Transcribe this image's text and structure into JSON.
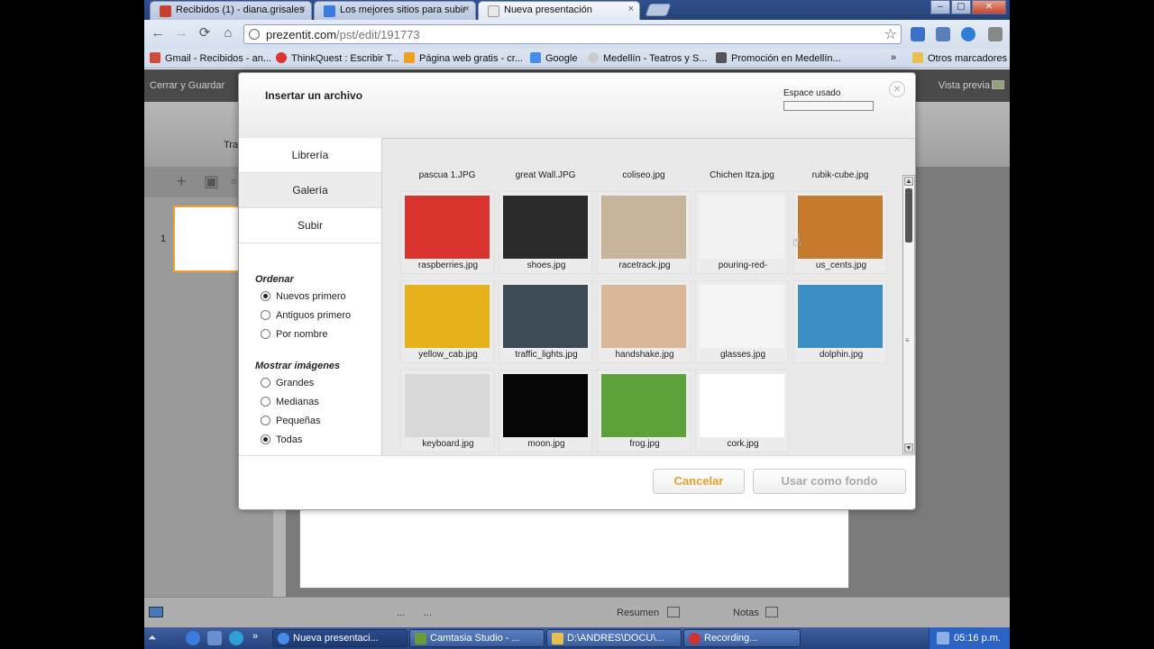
{
  "browser": {
    "tabs": [
      {
        "label": "Recibidos (1) - diana.grisales",
        "favicon_color": "#c8412f"
      },
      {
        "label": "Los mejores sitios para subir",
        "favicon_color": "#3a7be0"
      },
      {
        "label": "Nueva presentación",
        "favicon_color": "#e8e8e8"
      }
    ],
    "tab_close_glyph": "×",
    "window_buttons": [
      "–",
      "▢",
      "✕"
    ],
    "nav": {
      "back": "←",
      "forward": "→",
      "reload": "⟳",
      "home": "⌂"
    },
    "url_host": "prezentit.com",
    "url_path": "/pst/edit/191773",
    "star_glyph": "☆",
    "bookmarks": [
      {
        "label": "Gmail - Recibidos - an...",
        "icon_color": "#d14b3b"
      },
      {
        "label": "ThinkQuest : Escribir T...",
        "icon_color": "#d33"
      },
      {
        "label": "Página web gratis - cr...",
        "icon_color": "#f0a020"
      },
      {
        "label": "Google",
        "icon_color": "#4a8be8"
      },
      {
        "label": "Medellín - Teatros y S...",
        "icon_color": "#ccc"
      },
      {
        "label": "Promoción en Medellín...",
        "icon_color": "#555"
      }
    ],
    "bookmarks_overflow": "»",
    "other_bookmarks": "Otros marcadores"
  },
  "app": {
    "close_save": "Cerrar y Guardar",
    "preview": "Vista previa",
    "ribbon_label": "Tra",
    "slide_tools": [
      "+",
      "▣",
      "▫"
    ],
    "slide_number": "1",
    "status": {
      "dots1": "...",
      "dots2": "...",
      "summary": "Resumen",
      "notes": "Notas"
    }
  },
  "dialog": {
    "title": "Insertar un archivo",
    "space_used_label": "Espace usado",
    "space_used_fraction": 0.0,
    "close_glyph": "×",
    "nav_tabs": [
      "Librería",
      "Galería",
      "Subir"
    ],
    "selected_tab": "Galería",
    "sort_heading": "Ordenar",
    "sort_options": [
      {
        "label": "Nuevos primero",
        "checked": true
      },
      {
        "label": "Antiguos primero",
        "checked": false
      },
      {
        "label": "Por nombre",
        "checked": false
      }
    ],
    "show_heading": "Mostrar imágenes",
    "show_options": [
      {
        "label": "Grandes",
        "checked": false
      },
      {
        "label": "Medianas",
        "checked": false
      },
      {
        "label": "Pequeñas",
        "checked": false
      },
      {
        "label": "Todas",
        "checked": true
      }
    ],
    "top_row_labels": [
      "pascua 1.JPG",
      "great Wall.JPG",
      "coliseo.jpg",
      "Chichen Itza.jpg",
      "rubik-cube.jpg"
    ],
    "images": [
      {
        "name": "raspberries.jpg",
        "icon": "raspberries-image",
        "color": "#d8332c"
      },
      {
        "name": "shoes.jpg",
        "icon": "shoes-image",
        "color": "#2a2a2a"
      },
      {
        "name": "racetrack.jpg",
        "icon": "racetrack-image",
        "color": "#c8b49a"
      },
      {
        "name": "pouring-red-",
        "icon": "pouring-red-image",
        "color": "#f2f2f2"
      },
      {
        "name": "us_cents.jpg",
        "icon": "us-cents-image",
        "color": "#c57a2c"
      },
      {
        "name": "yellow_cab.jpg",
        "icon": "yellow-cab-image",
        "color": "#e6b21c"
      },
      {
        "name": "traffic_lights.jpg",
        "icon": "traffic-lights-image",
        "color": "#3b4a55"
      },
      {
        "name": "handshake.jpg",
        "icon": "handshake-image",
        "color": "#d9b89a"
      },
      {
        "name": "glasses.jpg",
        "icon": "glasses-image",
        "color": "#f5f5f5"
      },
      {
        "name": "dolphin.jpg",
        "icon": "dolphin-image",
        "color": "#3d8ec4"
      },
      {
        "name": "keyboard.jpg",
        "icon": "keyboard-image",
        "color": "#d8d8d8"
      },
      {
        "name": "moon.jpg",
        "icon": "moon-image",
        "color": "#050505"
      },
      {
        "name": "frog.jpg",
        "icon": "frog-image",
        "color": "#5da23a"
      },
      {
        "name": "cork.jpg",
        "icon": "cork-image",
        "color": "#ffffff"
      }
    ],
    "cancel_label": "Cancelar",
    "use_background_label": "Usar como fondo"
  },
  "taskbar": {
    "start_glyph": "⏶",
    "overflow": "»",
    "tasks": [
      {
        "label": "Nueva presentaci...",
        "icon_color": "#4a8be8",
        "active": true
      },
      {
        "label": "Camtasia Studio - ...",
        "icon_color": "#6a9a3a",
        "active": false
      },
      {
        "label": "D:\\ANDRES\\DOCU\\...",
        "icon_color": "#e8c050",
        "active": false
      },
      {
        "label": "Recording...",
        "icon_color": "#c33",
        "active": false
      }
    ],
    "clock": "05:16 p.m."
  }
}
